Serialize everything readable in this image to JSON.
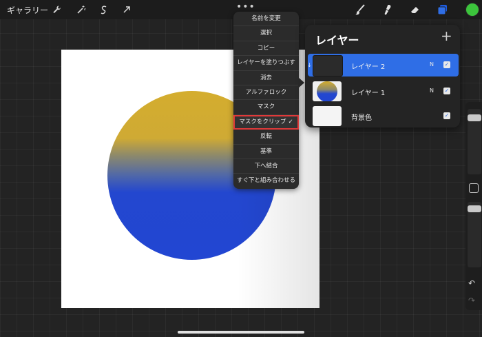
{
  "toolbar": {
    "gallery_label": "ギャラリー",
    "left_tools": [
      "wrench-icon",
      "magic-wand-icon",
      "selection-icon",
      "transform-arrow-icon"
    ],
    "right_tools": [
      "brush-icon",
      "smudge-icon",
      "eraser-icon",
      "layers-icon"
    ],
    "more_label": "•••",
    "active_color": "#3cc43c"
  },
  "menu": {
    "items": [
      {
        "label": "名前を変更",
        "highlighted": false
      },
      {
        "label": "選択",
        "highlighted": false
      },
      {
        "label": "コピー",
        "highlighted": false
      },
      {
        "label": "レイヤーを塗りつぶす",
        "highlighted": false
      },
      {
        "label": "消去",
        "highlighted": false
      },
      {
        "label": "アルファロック",
        "highlighted": false
      },
      {
        "label": "マスク",
        "highlighted": false
      },
      {
        "label": "マスクをクリップ",
        "highlighted": true,
        "check": "✓"
      },
      {
        "label": "反転",
        "highlighted": false
      },
      {
        "label": "基準",
        "highlighted": false
      },
      {
        "label": "下へ結合",
        "highlighted": false
      },
      {
        "label": "すぐ下と組み合わせる",
        "highlighted": false
      }
    ]
  },
  "layers": {
    "title": "レイヤー",
    "add_label": "+",
    "rows": [
      {
        "name": "レイヤー 2",
        "blend": "N",
        "selected": true,
        "clipped": true,
        "visible": true,
        "check": "✓"
      },
      {
        "name": "レイヤー 1",
        "blend": "N",
        "selected": false,
        "clipped": false,
        "visible": true,
        "check": "✓"
      },
      {
        "name": "背景色",
        "blend": "",
        "selected": false,
        "clipped": false,
        "visible": true,
        "check": "✓"
      }
    ]
  },
  "side": {
    "undo_label": "↶",
    "redo_label": "↷"
  },
  "canvas": {
    "background": "#ffffff",
    "gradient_top": "#d4ad2e",
    "gradient_bottom": "#2246d2"
  }
}
